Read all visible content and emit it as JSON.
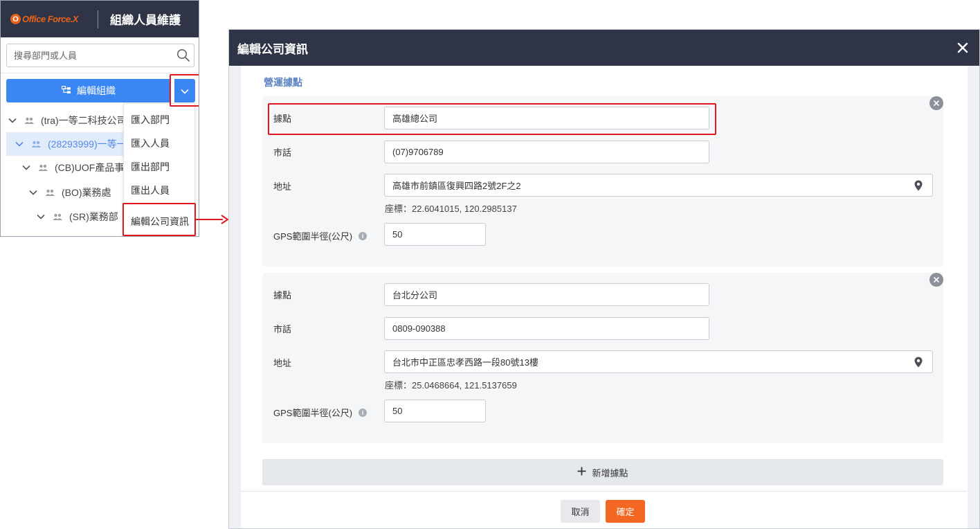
{
  "left_panel": {
    "logo_mark": "O",
    "logo_text": "Office Force.X",
    "title": "組織人員維護",
    "search_placeholder": "搜尋部門或人員",
    "edit_org_label": "編輯組織",
    "tree": [
      {
        "label": "(tra)一等二科技公司"
      },
      {
        "label": "(28293999)一等一"
      },
      {
        "label": "(CB)UOF產品事業"
      },
      {
        "label": "(BO)業務處"
      },
      {
        "label": "(SR)業務部"
      }
    ],
    "menu": {
      "import_dept": "匯入部門",
      "import_person": "匯入人員",
      "export_dept": "匯出部門",
      "export_person": "匯出人員",
      "edit_company": "編輯公司資訊"
    }
  },
  "modal": {
    "title": "編輯公司資訊",
    "section_title": "營運據點",
    "labels": {
      "location": "據點",
      "phone": "市話",
      "address": "地址",
      "gps_radius": "GPS範圍半徑(公尺)",
      "info_glyph": "i"
    },
    "locations": [
      {
        "name": "高雄總公司",
        "phone": "(07)9706789",
        "address": "高雄市前鎮區復興四路2號2F之2",
        "coords": "座標：22.6041015, 120.2985137",
        "gps_radius": "50"
      },
      {
        "name": "台北分公司",
        "phone": "0809-090388",
        "address": "台北市中正區忠孝西路一段80號13樓",
        "coords": "座標：25.0468664, 121.5137659",
        "gps_radius": "50"
      }
    ],
    "add_location_label": "新增據點",
    "cancel_label": "取消",
    "confirm_label": "確定"
  },
  "colors": {
    "header_bg": "#2f3547",
    "primary_blue": "#3a86f3",
    "accent_orange": "#f26722",
    "highlight_red": "#e0171f",
    "section_title": "#5f86c3"
  }
}
